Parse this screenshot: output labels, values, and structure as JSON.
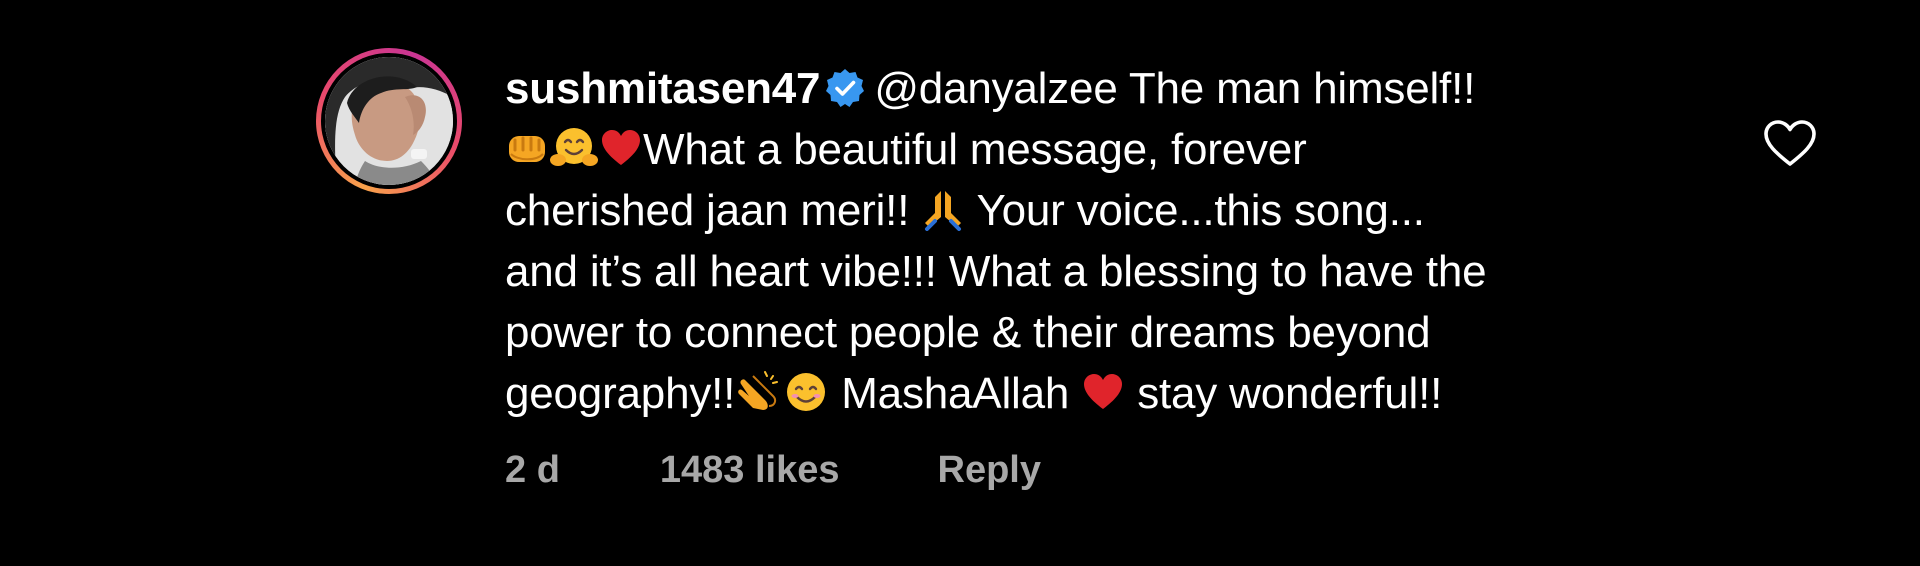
{
  "comment": {
    "username": "sushmitasen47",
    "verified": true,
    "mention": "@danyalzee",
    "lines": [
      " The man himself!!",
      "What a beautiful message, forever",
      "cherished jaan meri!! ",
      " Your voice...this song...",
      "and it’s all heart vibe!!! What a blessing to have the",
      "power to connect people & their dreams beyond",
      "geography!!",
      " MashaAllah ",
      " stay wonderful!!"
    ],
    "emojis": [
      "fist-emoji",
      "hugging-face-emoji",
      "red-heart-emoji",
      "folded-hands-emoji",
      "clapping-hands-emoji",
      "smiling-face-emoji",
      "red-heart-emoji"
    ],
    "timestamp": "2 d",
    "likes": "1483 likes",
    "reply_label": "Reply",
    "like_icon": "heart-outline-icon"
  },
  "colors": {
    "background": "#000000",
    "text": "#ffffff",
    "meta": "#a8a8a8",
    "verified_badge": "#3897f0",
    "heart": "#e0242b"
  }
}
